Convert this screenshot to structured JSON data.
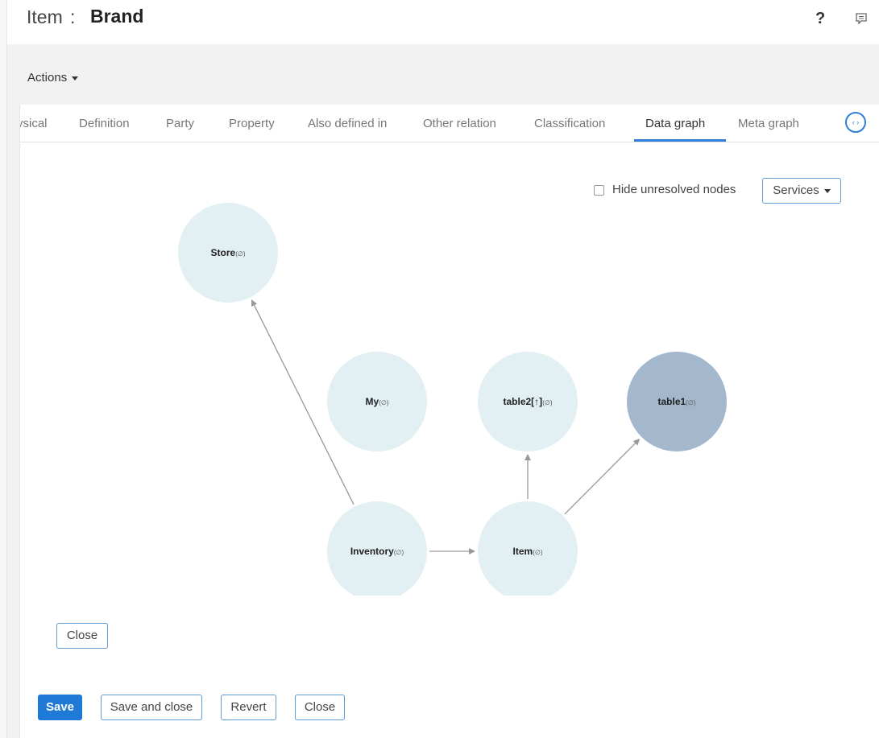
{
  "header": {
    "title_prefix": "Item",
    "title_separator": ":",
    "title": "Brand",
    "help_label": "?",
    "help_icon": "question-mark-icon",
    "chat_icon": "chat-bubble-icon"
  },
  "actions": {
    "label": "Actions"
  },
  "tabs": [
    {
      "label": "ysical",
      "active": false
    },
    {
      "label": "Definition",
      "active": false
    },
    {
      "label": "Party",
      "active": false
    },
    {
      "label": "Property",
      "active": false
    },
    {
      "label": "Also defined in",
      "active": false
    },
    {
      "label": "Other relation",
      "active": false
    },
    {
      "label": "Classification",
      "active": false
    },
    {
      "label": "Data graph",
      "active": true
    },
    {
      "label": "Meta graph",
      "active": false
    }
  ],
  "tab_scroll": {
    "label": "‹ ›",
    "icon": "scroll-arrows-icon"
  },
  "graph_controls": {
    "hide_unresolved_label": "Hide unresolved nodes",
    "hide_unresolved_checked": false,
    "services_label": "Services"
  },
  "graph": {
    "nodes": [
      {
        "id": "store",
        "name": "Store",
        "suffix": "(∅)",
        "resolved": false
      },
      {
        "id": "my",
        "name": "My",
        "suffix": "(∅)",
        "resolved": false
      },
      {
        "id": "table2",
        "name": "table2[↑]",
        "suffix": "(∅)",
        "resolved": false
      },
      {
        "id": "table1",
        "name": "table1",
        "suffix": "(∅)",
        "resolved": true
      },
      {
        "id": "inventory",
        "name": "Inventory",
        "suffix": "(∅)",
        "resolved": false
      },
      {
        "id": "item",
        "name": "Item",
        "suffix": "(∅)",
        "resolved": false
      }
    ],
    "edges": [
      {
        "from": "inventory",
        "to": "store"
      },
      {
        "from": "inventory",
        "to": "item"
      },
      {
        "from": "item",
        "to": "table2"
      },
      {
        "from": "item",
        "to": "table1"
      }
    ],
    "colors": {
      "node": "#e2eff3",
      "resolved_node": "#a3b8cc",
      "edge": "#999999"
    }
  },
  "graph_close_label": "Close",
  "footer": {
    "save_label": "Save",
    "save_close_label": "Save and close",
    "revert_label": "Revert",
    "close_label": "Close"
  },
  "colors": {
    "accent": "#2f7fd8",
    "primary_button": "#1e7ad6"
  }
}
